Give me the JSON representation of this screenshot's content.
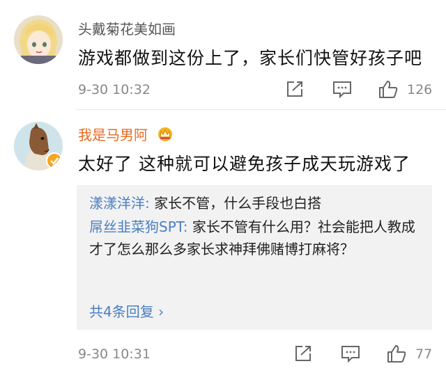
{
  "comments": [
    {
      "username": "头戴菊花美如画",
      "text": "游戏都做到这份上了，家长们快管好孩子吧",
      "time": "9-30 10:32",
      "likes": "126"
    },
    {
      "username": "我是马男阿",
      "text": "太好了 这种就可以避免孩子成天玩游戏了",
      "time": "9-30 10:31",
      "likes": "77",
      "replies": [
        {
          "name": "漾漾洋洋:",
          "text": " 家长不管，什么手段也白搭"
        },
        {
          "name": "屌丝韭菜狗SPT:",
          "text": " 家长不管有什么用？社会能把人教成才了怎么那么多家长求神拜佛赌博打麻将？"
        }
      ],
      "more_replies": "共4条回复 ›"
    }
  ],
  "colors": {
    "username_highlight": "#e86a1e",
    "link": "#4a7fc1",
    "meta": "#888888"
  },
  "icons": [
    "share-icon",
    "comment-icon",
    "like-icon",
    "crown-badge-icon",
    "verified-badge-icon"
  ]
}
